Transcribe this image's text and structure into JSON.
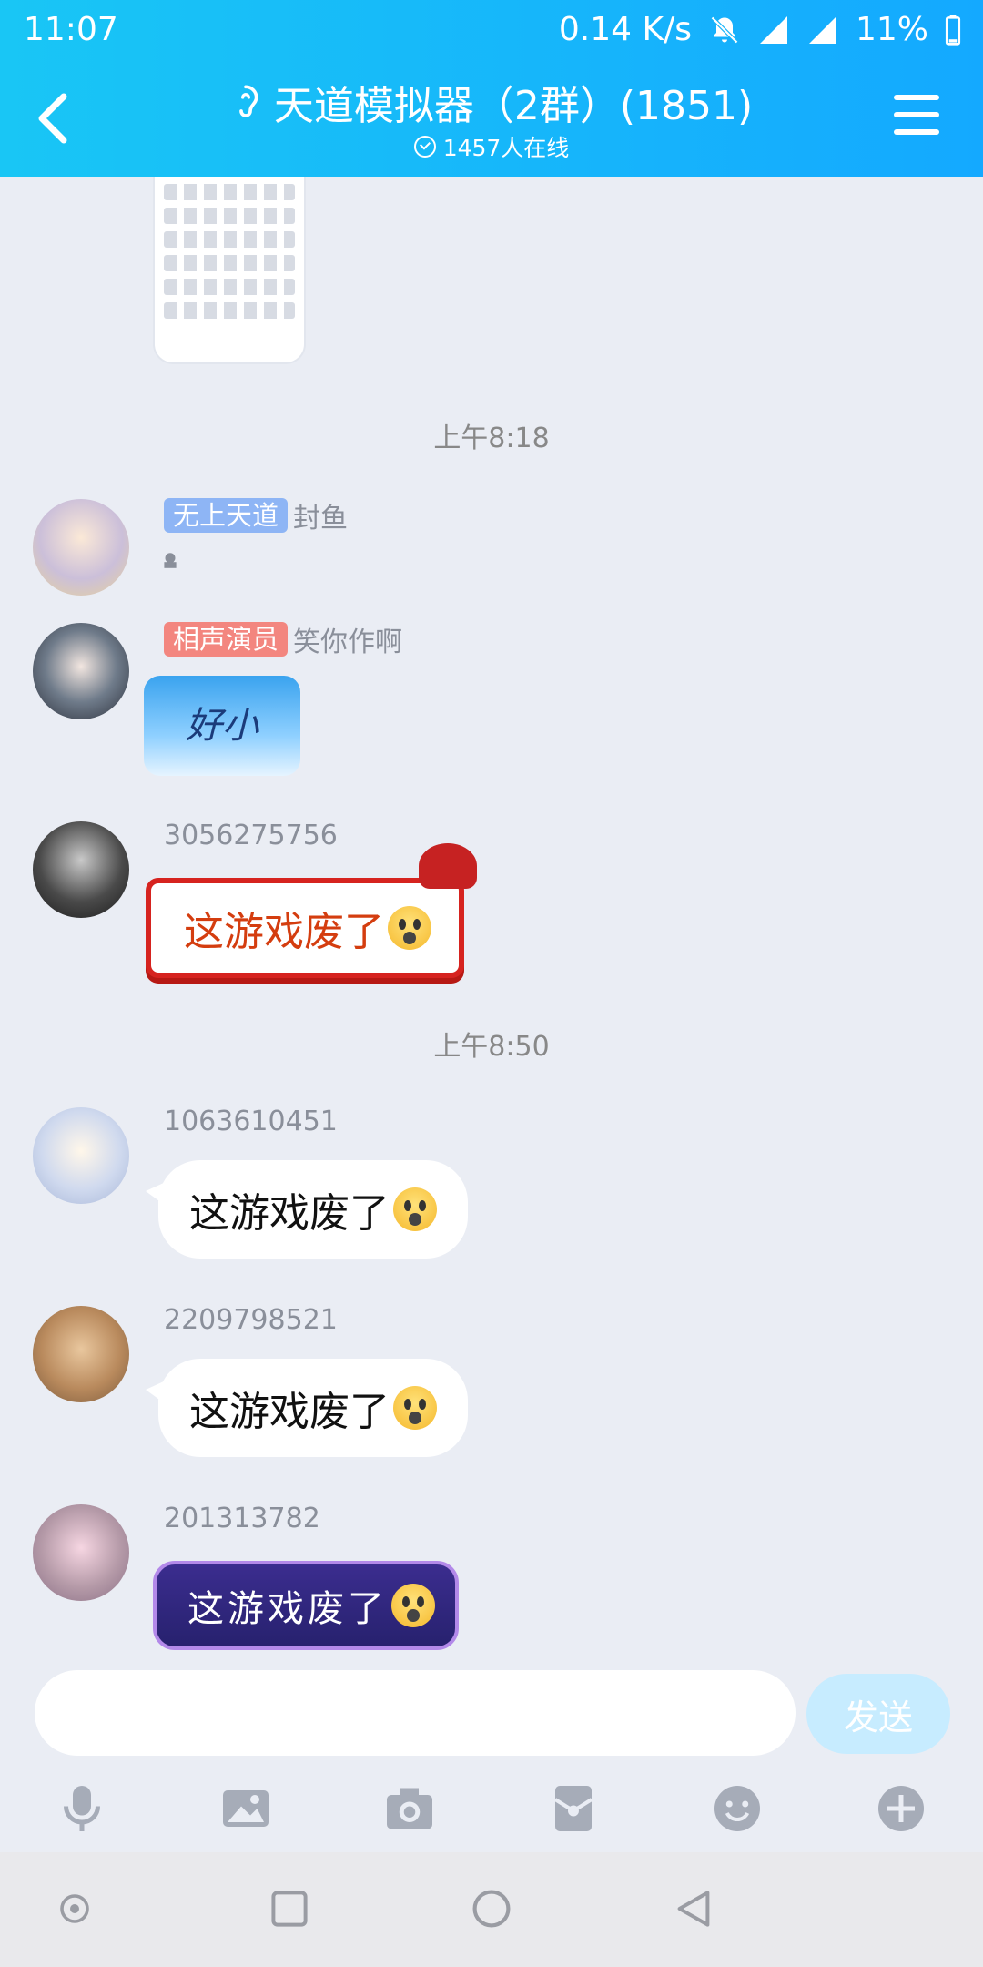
{
  "status_bar": {
    "time": "11:07",
    "speed": "0.14 K/s",
    "battery": "11%"
  },
  "header": {
    "title": "天道模拟器（2群）(1851)",
    "online": "1457人在线"
  },
  "messages": {
    "ts1": "上午8:18",
    "m1_tag": "无上天道",
    "m1_name": "封鱼",
    "m2_tag": "相声演员",
    "m2_name": "笑你作啊",
    "m2_image_text": "好小",
    "m3_name": "3056275756",
    "m3_text": "这游戏废了",
    "ts2": "上午8:50",
    "m4_name": "1063610451",
    "m4_text": "这游戏废了",
    "m5_name": "2209798521",
    "m5_text": "这游戏废了",
    "m6_name": "201313782",
    "m6_text": "这游戏废了"
  },
  "input": {
    "send_label": "发送",
    "value": ""
  },
  "icons": [
    "mic-icon",
    "image-icon",
    "camera-icon",
    "red-packet-icon",
    "emoji-icon",
    "plus-icon"
  ],
  "colors": {
    "header_start": "#19c6f5",
    "header_end": "#14a9ff",
    "background": "#eaedf4",
    "send_button": "#c7ecff"
  }
}
